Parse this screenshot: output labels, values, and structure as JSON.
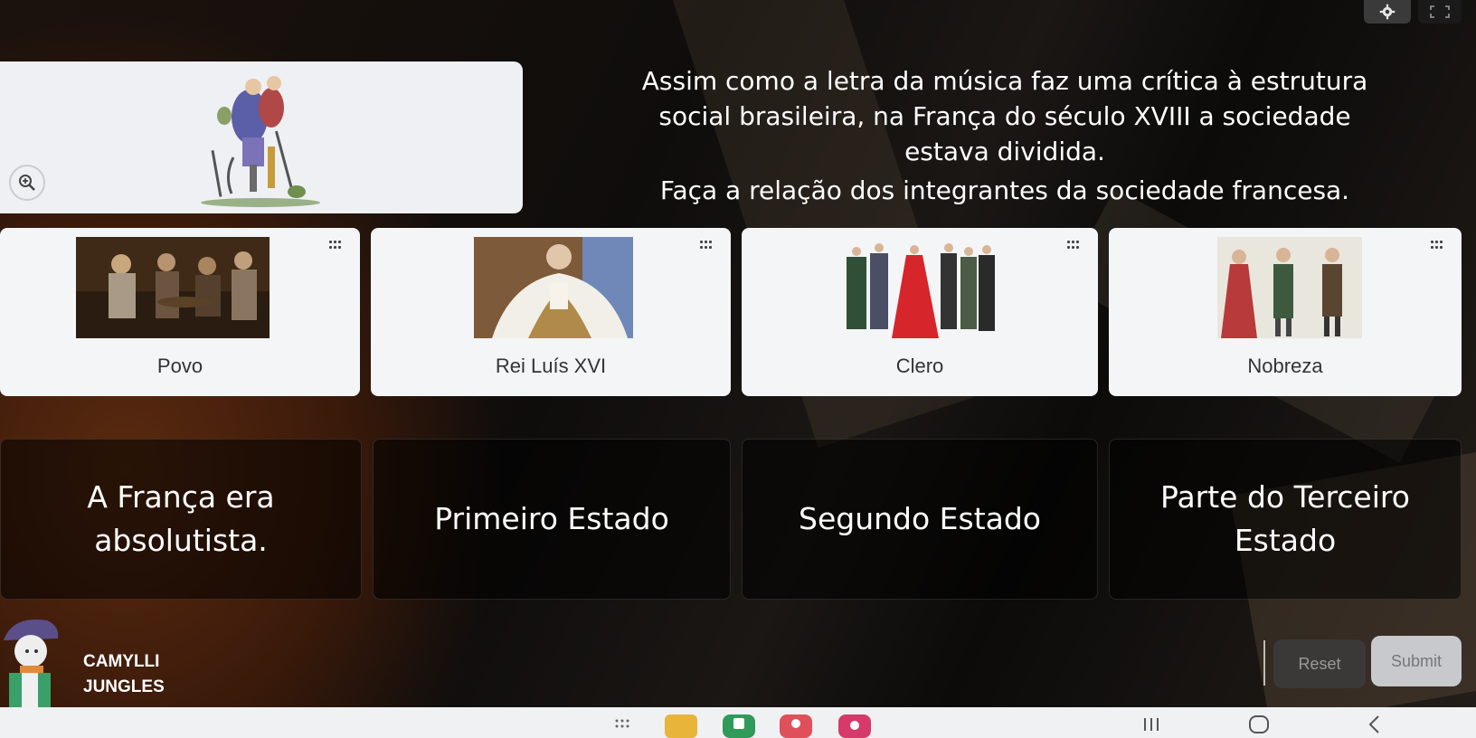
{
  "question": {
    "lines": [
      "Assim como a letra da música faz uma crítica à estrutura",
      "social brasileira, na França do século XVIII a sociedade",
      "estava dividida."
    ],
    "instruction": "Faça a relação dos integrantes da sociedade francesa."
  },
  "cards": [
    {
      "label": "Povo"
    },
    {
      "label": "Rei Luís XVI"
    },
    {
      "label": "Clero"
    },
    {
      "label": "Nobreza"
    }
  ],
  "zones": [
    {
      "label": "A França era absolutista."
    },
    {
      "label": "Primeiro Estado"
    },
    {
      "label": "Segundo Estado"
    },
    {
      "label": "Parte do Terceiro Estado"
    }
  ],
  "player": {
    "first_name": "CAMYLLI",
    "last_name": "JUNGLES"
  },
  "actions": {
    "reset_label": "Reset",
    "submit_label": "Submit"
  },
  "icons": {
    "settings": "gear-icon",
    "fullscreen": "fullscreen-icon",
    "zoom": "zoom-in-icon",
    "drag": "drag-handle-icon"
  },
  "colors": {
    "card_bg": "#f4f5f7",
    "zone_bg": "#0a0a0a",
    "submit_bg": "#c8c9cc",
    "reset_bg": "#3c3c3c"
  }
}
